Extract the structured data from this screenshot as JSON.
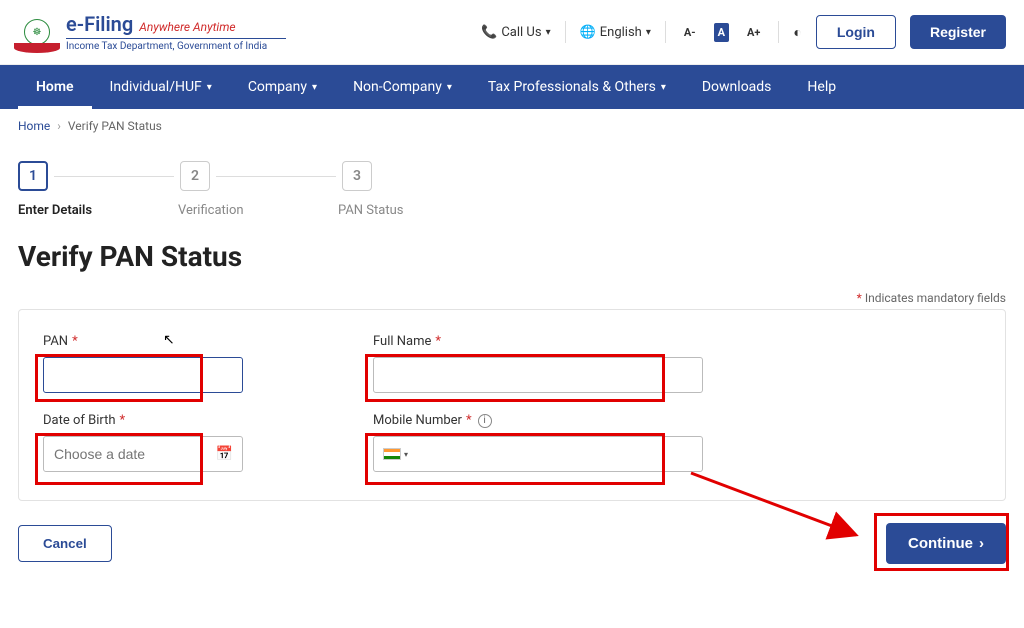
{
  "header": {
    "eFiling": "e-Filing",
    "tagline": "Anywhere Anytime",
    "dept": "Income Tax Department, Government of India",
    "callUs": "Call Us",
    "language": "English",
    "fontSmall": "A-",
    "fontNormal": "A",
    "fontLarge": "A+",
    "login": "Login",
    "register": "Register"
  },
  "nav": {
    "home": "Home",
    "individual": "Individual/HUF",
    "company": "Company",
    "nonCompany": "Non-Company",
    "taxPro": "Tax Professionals & Others",
    "downloads": "Downloads",
    "help": "Help"
  },
  "breadcrumb": {
    "home": "Home",
    "current": "Verify PAN Status"
  },
  "steps": {
    "s1": "1",
    "s2": "2",
    "s3": "3",
    "l1": "Enter Details",
    "l2": "Verification",
    "l3": "PAN Status"
  },
  "page": {
    "title": "Verify PAN Status",
    "mandatory": "Indicates mandatory fields"
  },
  "form": {
    "pan": "PAN",
    "fullName": "Full Name",
    "dob": "Date of Birth",
    "dobPlaceholder": "Choose a date",
    "mobile": "Mobile Number"
  },
  "actions": {
    "cancel": "Cancel",
    "continue": "Continue"
  }
}
